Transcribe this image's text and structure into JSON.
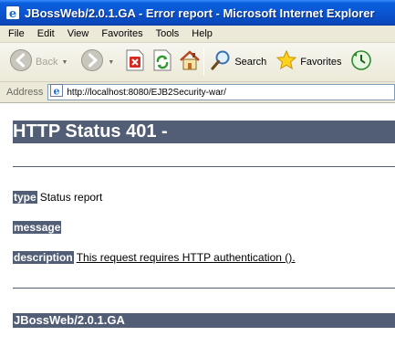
{
  "window": {
    "title": "JBossWeb/2.0.1.GA - Error report - Microsoft Internet Explorer",
    "icon": "ie-icon"
  },
  "menu": [
    "File",
    "Edit",
    "View",
    "Favorites",
    "Tools",
    "Help"
  ],
  "toolbar": {
    "back_label": "Back",
    "search_label": "Search",
    "favorites_label": "Favorites"
  },
  "address": {
    "label": "Address",
    "url": "http://localhost:8080/EJB2Security-war/"
  },
  "page": {
    "heading": "HTTP Status 401 -",
    "type_label": "type",
    "type_value": "Status report",
    "message_label": "message",
    "message_value": "",
    "description_label": "description",
    "description_value": "This request requires HTTP authentication ().",
    "footer": "JBossWeb/2.0.1.GA"
  },
  "colors": {
    "titlebar": "#0a53d0",
    "heading_bg": "#525d76",
    "chrome": "#ece9d8"
  }
}
